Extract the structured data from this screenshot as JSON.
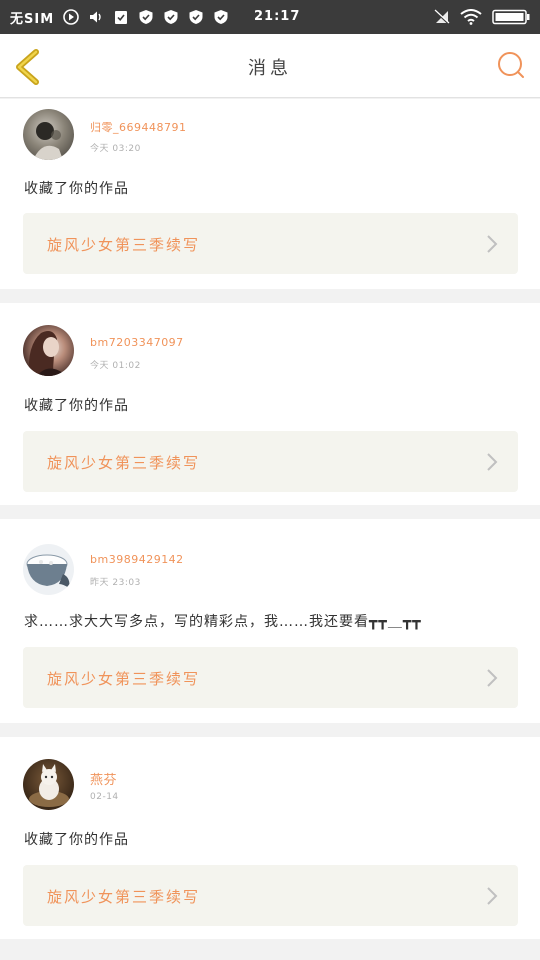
{
  "status_bar": {
    "sim": "无SIM",
    "time": "21:17",
    "icons": [
      "play-icon",
      "volume-icon",
      "clipboard-check-icon",
      "shield-check-icon",
      "shield-check-icon",
      "shield-check-icon",
      "shield-check-icon",
      "mute-signal-icon",
      "wifi-icon",
      "battery-icon"
    ]
  },
  "header": {
    "title": "消息"
  },
  "messages": [
    {
      "username": "归零_669448791",
      "time": "今天 03:20",
      "text": "收藏了你的作品",
      "work_title": "旋风少女第三季续写"
    },
    {
      "username": "bm7203347097",
      "time": "今天 01:02",
      "text": "收藏了你的作品",
      "work_title": "旋风少女第三季续写"
    },
    {
      "username": "bm3989429142",
      "time": "昨天 23:03",
      "text": "求……求大大写多点，写的精彩点，我……我还要看┳┳＿┳┳",
      "work_title": "旋风少女第三季续写"
    },
    {
      "username": "燕芬",
      "time": "02-14",
      "text": "收藏了你的作品",
      "work_title": "旋风少女第三季续写"
    }
  ],
  "colors": {
    "accent": "#f0935a",
    "back_icon": "#c9a41c",
    "status_bar_bg": "#3b3b3b",
    "page_bg": "#f2f2f2",
    "work_bg": "#f4f4ee"
  }
}
